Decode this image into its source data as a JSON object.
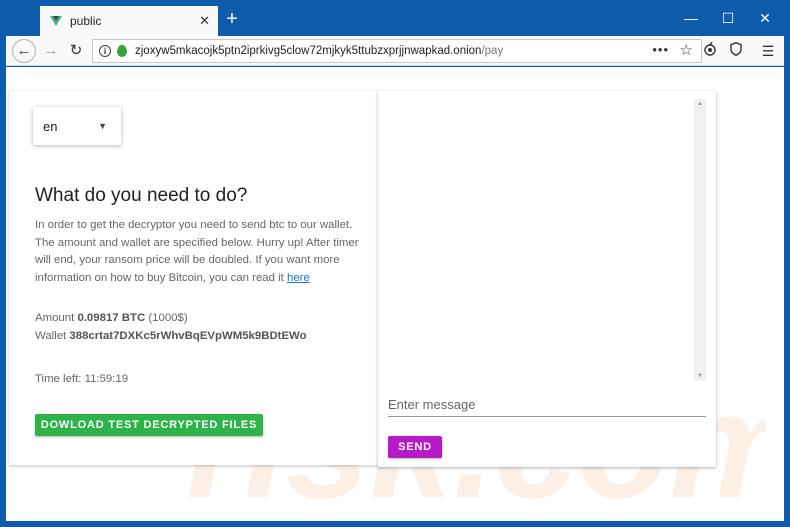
{
  "browser": {
    "tab_title": "public",
    "new_tab": "+",
    "url_domain": "zjoxyw5mkacojk5ptn2iprkivg5clow72mjkyk5ttubzxprjjnwapkad.onion",
    "url_path": "/pay",
    "minimize": "—",
    "maximize": "☐",
    "close": "✕",
    "tab_close": "✕",
    "back": "←",
    "forward": "→",
    "reload": "↻",
    "menu_dots": "•••",
    "star": "☆",
    "hamburger": "☰"
  },
  "page": {
    "language": "en",
    "heading": "What do you need to do?",
    "description": "In order to get the decryptor you need to send btc to our wallet. The amount and wallet are specified below. Hurry up! After timer will end, your ransom price will be doubled. If you want more information on how to buy Bitcoin, you can read it ",
    "description_link": "here",
    "amount_label": "Amount",
    "amount_btc": "0.09817 BTC",
    "amount_usd": "(1000$)",
    "wallet_label": "Wallet",
    "wallet_address": "388crtat7DXKc5rWhvBqEVpWM5k9BDtEWo",
    "time_left_label": "Time left:",
    "time_left_value": "11:59:19",
    "download_button": "DOWLOAD TEST DECRYPTED FILES"
  },
  "chat": {
    "placeholder": "Enter message",
    "send_button": "SEND"
  },
  "colors": {
    "titlebar": "#0f5cad",
    "download_button": "#2db34a",
    "send_button": "#b51cc6",
    "link": "#1a73e8"
  }
}
